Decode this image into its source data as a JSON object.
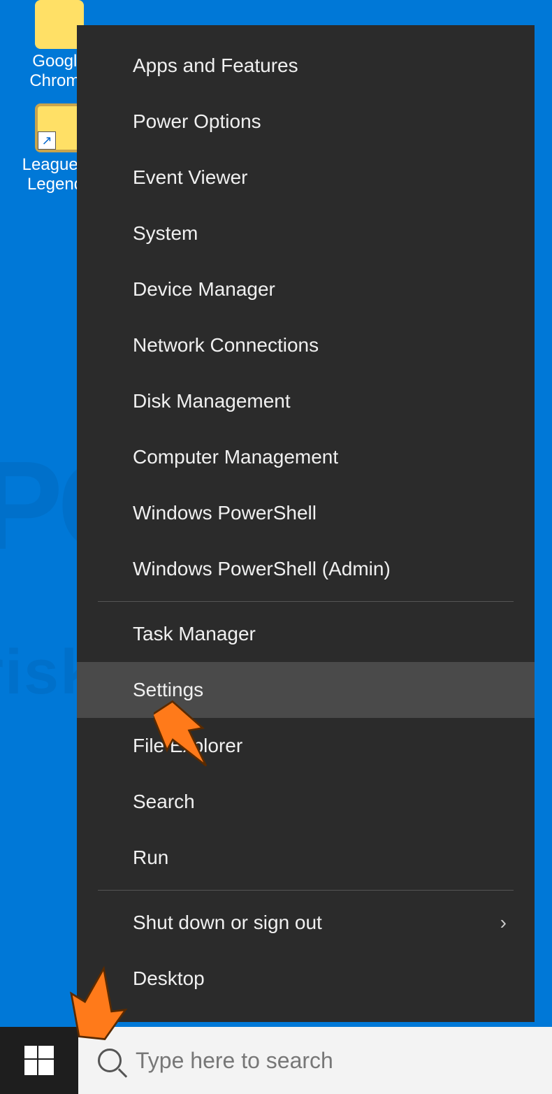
{
  "desktop_icons": [
    {
      "label": "Google Chrome",
      "kind": "chrome"
    },
    {
      "label": "League of Legends",
      "kind": "lol"
    }
  ],
  "winx_menu": {
    "groups": [
      [
        "Apps and Features",
        "Power Options",
        "Event Viewer",
        "System",
        "Device Manager",
        "Network Connections",
        "Disk Management",
        "Computer Management",
        "Windows PowerShell",
        "Windows PowerShell (Admin)"
      ],
      [
        "Task Manager",
        "Settings",
        "File Explorer",
        "Search",
        "Run"
      ],
      [
        "Shut down or sign out",
        "Desktop"
      ]
    ],
    "hovered_item": "Settings",
    "submenu_items": [
      "Shut down or sign out"
    ]
  },
  "taskbar": {
    "search_placeholder": "Type here to search"
  },
  "annotations": {
    "arrow1_target": "Settings",
    "arrow2_target": "Start button"
  },
  "watermark_text": "PCrisk.com"
}
